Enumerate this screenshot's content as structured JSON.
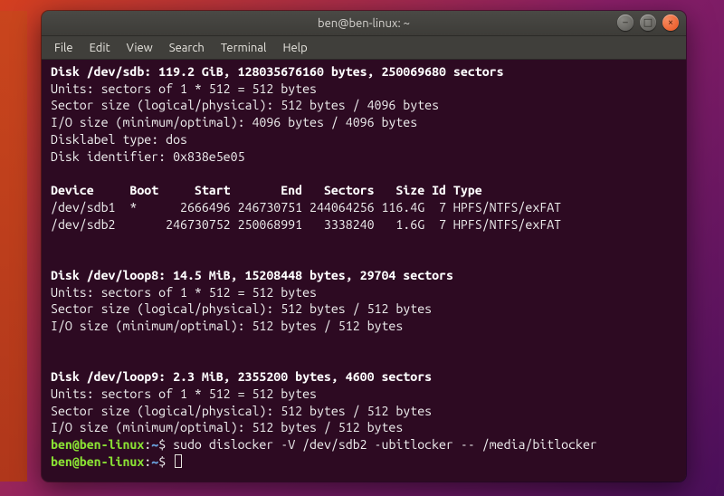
{
  "window": {
    "title": "ben@ben-linux: ~"
  },
  "menubar": {
    "items": [
      "File",
      "Edit",
      "View",
      "Search",
      "Terminal",
      "Help"
    ]
  },
  "term": {
    "lines": [
      {
        "c": "bold",
        "t": "Disk /dev/sdb: 119.2 GiB, 128035676160 bytes, 250069680 sectors"
      },
      {
        "t": "Units: sectors of 1 * 512 = 512 bytes"
      },
      {
        "t": "Sector size (logical/physical): 512 bytes / 4096 bytes"
      },
      {
        "t": "I/O size (minimum/optimal): 4096 bytes / 4096 bytes"
      },
      {
        "t": "Disklabel type: dos"
      },
      {
        "t": "Disk identifier: 0x838e5e05"
      },
      {
        "t": ""
      },
      {
        "c": "bold",
        "t": "Device     Boot     Start       End   Sectors   Size Id Type"
      },
      {
        "t": "/dev/sdb1  *      2666496 246730751 244064256 116.4G  7 HPFS/NTFS/exFAT"
      },
      {
        "t": "/dev/sdb2       246730752 250068991   3338240   1.6G  7 HPFS/NTFS/exFAT"
      },
      {
        "t": ""
      },
      {
        "t": ""
      },
      {
        "c": "bold",
        "t": "Disk /dev/loop8: 14.5 MiB, 15208448 bytes, 29704 sectors"
      },
      {
        "t": "Units: sectors of 1 * 512 = 512 bytes"
      },
      {
        "t": "Sector size (logical/physical): 512 bytes / 512 bytes"
      },
      {
        "t": "I/O size (minimum/optimal): 512 bytes / 512 bytes"
      },
      {
        "t": ""
      },
      {
        "t": ""
      },
      {
        "c": "bold",
        "t": "Disk /dev/loop9: 2.3 MiB, 2355200 bytes, 4600 sectors"
      },
      {
        "t": "Units: sectors of 1 * 512 = 512 bytes"
      },
      {
        "t": "Sector size (logical/physical): 512 bytes / 512 bytes"
      },
      {
        "t": "I/O size (minimum/optimal): 512 bytes / 512 bytes"
      }
    ],
    "prompts": [
      {
        "user": "ben@ben-linux",
        "path": "~",
        "cmd": "sudo dislocker -V /dev/sdb2 -ubitlocker -- /media/bitlocker"
      },
      {
        "user": "ben@ben-linux",
        "path": "~",
        "cmd": ""
      }
    ]
  },
  "controls": {
    "minimize": "–",
    "maximize": "□",
    "close": "×"
  }
}
